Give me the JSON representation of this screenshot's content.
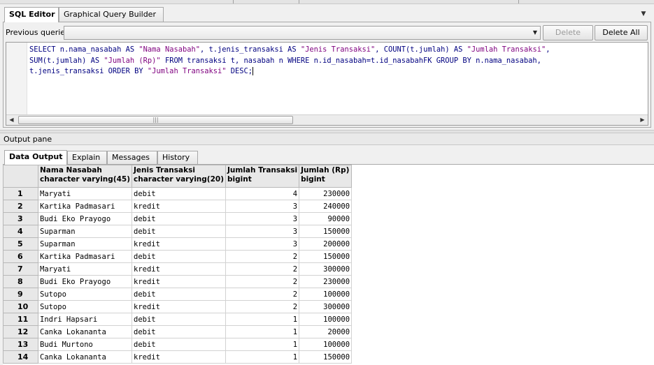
{
  "editor_tabs": [
    "SQL Editor",
    "Graphical Query Builder"
  ],
  "previous_queries": {
    "label": "Previous queries",
    "selected": "",
    "delete_label": "Delete",
    "delete_all_label": "Delete All"
  },
  "sql": {
    "parts": [
      {
        "t": "SELECT n.nama_nasabah AS ",
        "c": "kw"
      },
      {
        "t": "\"Nama Nasabah\"",
        "c": "str"
      },
      {
        "t": ", t.jenis_transaksi AS ",
        "c": "kw"
      },
      {
        "t": "\"Jenis Transaksi\"",
        "c": "str"
      },
      {
        "t": ", COUNT(t.jumlah) AS ",
        "c": "kw"
      },
      {
        "t": "\"Jumlah Transaksi\"",
        "c": "str"
      },
      {
        "t": ",\nSUM(t.jumlah) AS ",
        "c": "kw"
      },
      {
        "t": "\"Jumlah (Rp)\"",
        "c": "str"
      },
      {
        "t": " FROM transaksi t, nasabah n WHERE n.id_nasabah=t.id_nasabahFK GROUP BY n.nama_nasabah,\nt.jenis_transaksi ORDER BY ",
        "c": "kw"
      },
      {
        "t": "\"Jumlah Transaksi\"",
        "c": "str"
      },
      {
        "t": " DESC;",
        "c": "kw"
      }
    ]
  },
  "output_pane_title": "Output pane",
  "output_tabs": [
    "Data Output",
    "Explain",
    "Messages",
    "History"
  ],
  "grid": {
    "columns": [
      {
        "name": "Nama Nasabah",
        "type": "character varying(45)",
        "align": "left"
      },
      {
        "name": "Jenis Transaksi",
        "type": "character varying(20)",
        "align": "left"
      },
      {
        "name": "Jumlah Transaksi",
        "type": "bigint",
        "align": "right"
      },
      {
        "name": "Jumlah (Rp)",
        "type": "bigint",
        "align": "right"
      }
    ],
    "rows": [
      [
        "1",
        "Maryati",
        "debit",
        "4",
        "230000"
      ],
      [
        "2",
        "Kartika Padmasari",
        "kredit",
        "3",
        "240000"
      ],
      [
        "3",
        "Budi Eko Prayogo",
        "debit",
        "3",
        "90000"
      ],
      [
        "4",
        "Suparman",
        "debit",
        "3",
        "150000"
      ],
      [
        "5",
        "Suparman",
        "kredit",
        "3",
        "200000"
      ],
      [
        "6",
        "Kartika Padmasari",
        "debit",
        "2",
        "150000"
      ],
      [
        "7",
        "Maryati",
        "kredit",
        "2",
        "300000"
      ],
      [
        "8",
        "Budi Eko Prayogo",
        "kredit",
        "2",
        "230000"
      ],
      [
        "9",
        "Sutopo",
        "debit",
        "2",
        "100000"
      ],
      [
        "10",
        "Sutopo",
        "kredit",
        "2",
        "300000"
      ],
      [
        "11",
        "Indri Hapsari",
        "debit",
        "1",
        "100000"
      ],
      [
        "12",
        "Canka Lokananta",
        "debit",
        "1",
        "20000"
      ],
      [
        "13",
        "Budi Murtono",
        "debit",
        "1",
        "100000"
      ],
      [
        "14",
        "Canka Lokananta",
        "kredit",
        "1",
        "150000"
      ]
    ]
  },
  "icons": {
    "combo_arrow": "chevron-down-icon",
    "tab_menu": "tab-menu-icon",
    "scroll_left": "arrow-left-icon",
    "scroll_right": "arrow-right-icon"
  }
}
